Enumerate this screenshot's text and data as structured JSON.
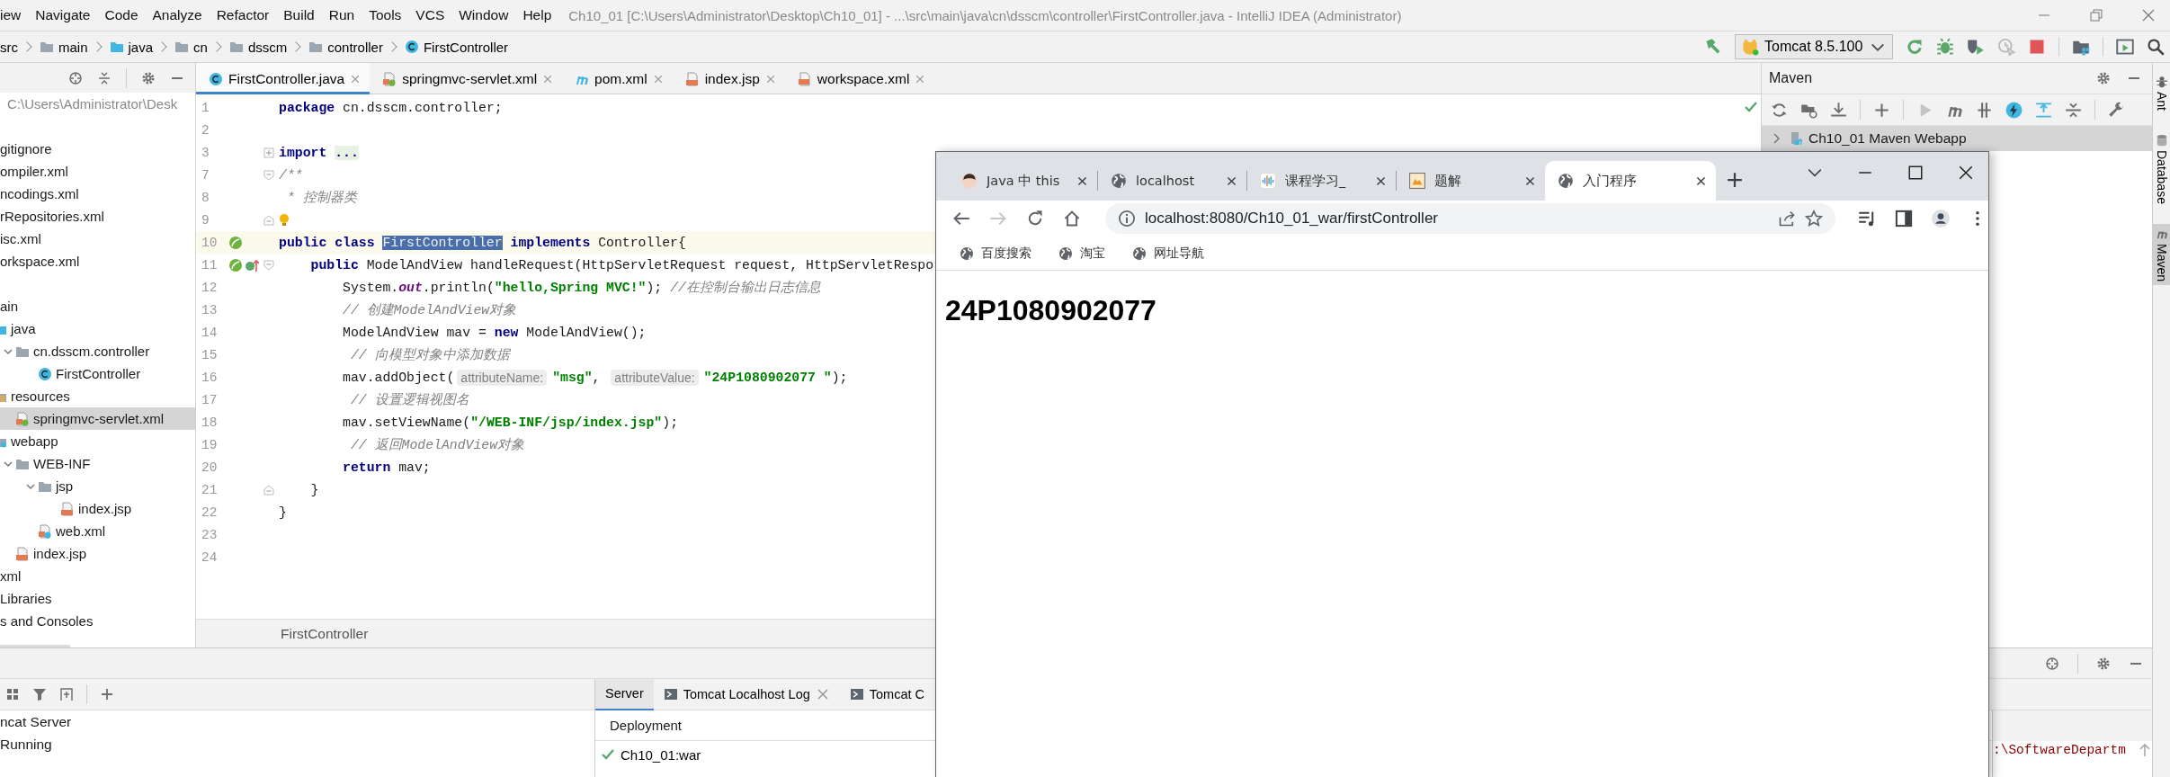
{
  "ide": {
    "menu": [
      "iew",
      "Navigate",
      "Code",
      "Analyze",
      "Refactor",
      "Build",
      "Run",
      "Tools",
      "VCS",
      "Window",
      "Help"
    ],
    "title": "Ch10_01 [C:\\Users\\Administrator\\Desktop\\Ch10_01] - ...\\src\\main\\java\\cn\\dsscm\\controller\\FirstController.java - IntelliJ IDEA (Administrator)",
    "breadcrumbs": [
      {
        "label": "src"
      },
      {
        "label": "main",
        "kind": "folder"
      },
      {
        "label": "java",
        "kind": "source"
      },
      {
        "label": "cn",
        "kind": "folder"
      },
      {
        "label": "dsscm",
        "kind": "folder"
      },
      {
        "label": "controller",
        "kind": "folder"
      },
      {
        "label": "FirstController",
        "kind": "class"
      }
    ],
    "run_config": "Tomcat 8.5.100",
    "project": {
      "path": "C:\\Users\\Administrator\\Desk",
      "tree": [
        {
          "label": "gitignore",
          "selected": false
        },
        {
          "label": "ompiler.xml",
          "selected": false
        },
        {
          "label": "ncodings.xml",
          "selected": false
        },
        {
          "label": "rRepositories.xml",
          "selected": false
        },
        {
          "label": "isc.xml",
          "selected": false
        },
        {
          "label": "orkspace.xml",
          "selected": false
        },
        {
          "label": "ain",
          "selected": false,
          "children": [
            {
              "label": "java",
              "kind": "source",
              "selected": false,
              "children": [
                {
                  "label": "cn.dsscm.controller",
                  "kind": "folder",
                  "expanded": true,
                  "selected": false,
                  "children": [
                    {
                      "label": "FirstController",
                      "kind": "class",
                      "selected": false
                    }
                  ]
                }
              ]
            },
            {
              "label": "resources",
              "kind": "resources",
              "selected": false,
              "children": [
                {
                  "label": "springmvc-servlet.xml",
                  "kind": "spring",
                  "selected": true
                }
              ]
            },
            {
              "label": "webapp",
              "kind": "web",
              "selected": false,
              "children": [
                {
                  "label": "WEB-INF",
                  "kind": "folder",
                  "expanded": true,
                  "selected": false,
                  "children": [
                    {
                      "label": "jsp",
                      "kind": "folder",
                      "expanded": true,
                      "selected": false,
                      "children": [
                        {
                          "label": "index.jsp",
                          "kind": "jsp",
                          "selected": false
                        }
                      ]
                    },
                    {
                      "label": "web.xml",
                      "kind": "webxml",
                      "selected": false
                    }
                  ]
                },
                {
                  "label": "index.jsp",
                  "kind": "jsp",
                  "selected": false
                }
              ]
            }
          ]
        },
        {
          "label": "xml",
          "selected": false
        },
        {
          "label": "Libraries",
          "selected": false
        },
        {
          "label": "s and Consoles",
          "selected": false
        }
      ]
    },
    "editor": {
      "tabs": [
        {
          "label": "FirstController.java",
          "kind": "class",
          "selected": true
        },
        {
          "label": "springmvc-servlet.xml",
          "kind": "spring",
          "selected": false
        },
        {
          "label": "pom.xml",
          "kind": "maven",
          "selected": false
        },
        {
          "label": "index.jsp",
          "kind": "jsp",
          "selected": false
        },
        {
          "label": "workspace.xml",
          "kind": "xml",
          "selected": false
        }
      ],
      "lines": [
        {
          "number": "1",
          "current": false,
          "tokens": [
            {
              "kind": "keyword",
              "text": "package"
            },
            {
              "kind": "plain",
              "text": " cn.dsscm.controller;"
            }
          ]
        },
        {
          "number": "2",
          "current": false
        },
        {
          "number": "3",
          "current": false,
          "marks": [
            {
              "kind": "fold-collapsed"
            }
          ],
          "tokens": [
            {
              "kind": "keyword",
              "text": "import "
            },
            {
              "kind": "folded",
              "text": "..."
            }
          ]
        },
        {
          "number": "7",
          "current": false,
          "marks": [
            {
              "kind": "fold-start"
            }
          ],
          "tokens": [
            {
              "kind": "comment",
              "text": "/**"
            }
          ]
        },
        {
          "number": "8",
          "current": false,
          "tokens": [
            {
              "kind": "comment",
              "text": " * 控制器类"
            }
          ]
        },
        {
          "number": "9",
          "current": false,
          "marks": [
            {
              "kind": "fold-end"
            },
            {
              "kind": "bulb"
            }
          ]
        },
        {
          "number": "10",
          "current": true,
          "marks": [
            {
              "kind": "bean"
            }
          ],
          "tokens": [
            {
              "kind": "keyword",
              "text": "public class "
            },
            {
              "kind": "selection",
              "text": "FirstController"
            },
            {
              "kind": "keyword",
              "text": " implements"
            },
            {
              "kind": "plain",
              "text": " Controller{"
            }
          ]
        },
        {
          "number": "11",
          "current": false,
          "marks": [
            {
              "kind": "bean"
            },
            {
              "kind": "implements"
            },
            {
              "kind": "fold-start"
            }
          ],
          "tokens": [
            {
              "kind": "keyword",
              "text": "    public"
            },
            {
              "kind": "plain",
              "text": " ModelAndView handleRequest(HttpServletRequest request, HttpServletRespo"
            }
          ]
        },
        {
          "number": "12",
          "current": false,
          "tokens": [
            {
              "kind": "plain",
              "text": "        System."
            },
            {
              "kind": "static",
              "text": "out"
            },
            {
              "kind": "plain",
              "text": ".println("
            },
            {
              "kind": "string",
              "text": "\"hello,Spring MVC!\""
            },
            {
              "kind": "plain",
              "text": "); "
            },
            {
              "kind": "comment",
              "text": "//在控制台输出日志信息"
            }
          ]
        },
        {
          "number": "13",
          "current": false,
          "tokens": [
            {
              "kind": "comment",
              "text": "        // 创建ModelAndView对象"
            }
          ]
        },
        {
          "number": "14",
          "current": false,
          "tokens": [
            {
              "kind": "plain",
              "text": "        ModelAndView mav = "
            },
            {
              "kind": "keyword",
              "text": "new"
            },
            {
              "kind": "plain",
              "text": " ModelAndView();"
            }
          ]
        },
        {
          "number": "15",
          "current": false,
          "tokens": [
            {
              "kind": "comment",
              "text": "         // 向模型对象中添加数据"
            }
          ]
        },
        {
          "number": "16",
          "current": false,
          "tokens": [
            {
              "kind": "plain",
              "text": "        mav.addObject("
            },
            {
              "kind": "hint",
              "text": "attributeName:"
            },
            {
              "kind": "string",
              "text": "\"msg\""
            },
            {
              "kind": "plain",
              "text": ", "
            },
            {
              "kind": "hint",
              "text": "attributeValue:"
            },
            {
              "kind": "string",
              "text": "\"24P1080902077 \""
            },
            {
              "kind": "plain",
              "text": ");"
            }
          ]
        },
        {
          "number": "17",
          "current": false,
          "tokens": [
            {
              "kind": "comment",
              "text": "         // 设置逻辑视图名"
            }
          ]
        },
        {
          "number": "18",
          "current": false,
          "tokens": [
            {
              "kind": "plain",
              "text": "        mav.setViewName("
            },
            {
              "kind": "string",
              "text": "\"/WEB-INF/jsp/index.jsp\""
            },
            {
              "kind": "plain",
              "text": ");"
            }
          ]
        },
        {
          "number": "19",
          "current": false,
          "tokens": [
            {
              "kind": "comment",
              "text": "         // 返回ModelAndView对象"
            }
          ]
        },
        {
          "number": "20",
          "current": false,
          "tokens": [
            {
              "kind": "keyword",
              "text": "        return"
            },
            {
              "kind": "plain",
              "text": " mav;"
            }
          ]
        },
        {
          "number": "21",
          "current": false,
          "marks": [
            {
              "kind": "fold-end"
            }
          ],
          "tokens": [
            {
              "kind": "plain",
              "text": "    }"
            }
          ]
        },
        {
          "number": "22",
          "current": false,
          "tokens": [
            {
              "kind": "plain",
              "text": "}"
            }
          ]
        },
        {
          "number": "23",
          "current": false
        },
        {
          "number": "24",
          "current": false
        }
      ],
      "breadcrumb": "FirstController"
    },
    "maven": {
      "title": "Maven",
      "projects": [
        {
          "label": "Ch10_01 Maven Webapp",
          "selected": true
        }
      ]
    },
    "side_tabs": [
      {
        "label": "Ant",
        "kind": "ant",
        "selected": false
      },
      {
        "label": "Database",
        "kind": "database",
        "selected": false
      },
      {
        "label": "Maven",
        "kind": "maven",
        "selected": true
      }
    ],
    "services": {
      "tree": [
        "ncat Server",
        "Running"
      ],
      "tabs": [
        {
          "label": "Server",
          "selected": true,
          "closable": false
        },
        {
          "label": "Tomcat Localhost Log",
          "kind": "console",
          "closable": true,
          "selected": false
        },
        {
          "label": "Tomcat C",
          "kind": "console",
          "closable": false,
          "selected": false
        }
      ],
      "deployment_header": "Deployment",
      "deployments": [
        {
          "label": "Ch10_01:war",
          "kind": "deployed"
        }
      ],
      "console": [
        ":\\SoftwareDepartm"
      ]
    }
  },
  "browser": {
    "tabs": [
      {
        "title": "Java 中 this",
        "kind": "avatar",
        "selected": false
      },
      {
        "title": "localhost",
        "kind": "globe",
        "selected": false
      },
      {
        "title": "课程学习_",
        "kind": "bars",
        "selected": false
      },
      {
        "title": "题解",
        "kind": "image",
        "selected": false
      },
      {
        "title": "入门程序",
        "kind": "globe",
        "selected": true
      }
    ],
    "forward_enabled": false,
    "url": "localhost:8080/Ch10_01_war/firstController",
    "bookmarks": [
      "百度搜索",
      "淘宝",
      "网址导航"
    ],
    "heading": "24P1080902077"
  }
}
